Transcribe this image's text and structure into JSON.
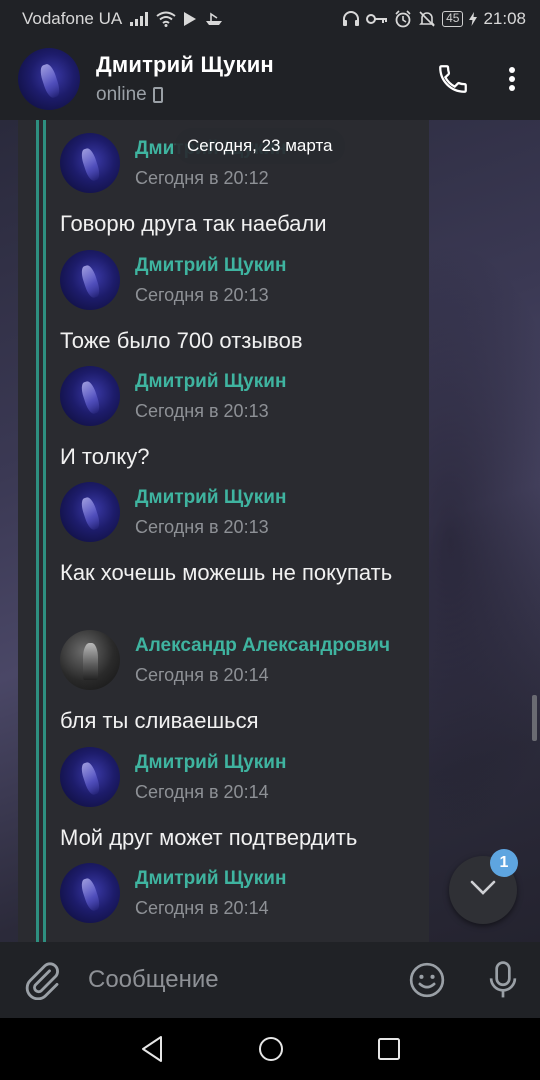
{
  "statusbar": {
    "carrier": "Vodafone UA",
    "battery": "45",
    "time": "21:08",
    "icons": [
      "signal-icon",
      "wifi-icon",
      "play-icon",
      "boat-icon",
      "headset-icon",
      "key-icon",
      "alarm-icon",
      "mute-icon",
      "charging-icon"
    ]
  },
  "header": {
    "name": "Дмитрий Щукин",
    "status": "online",
    "icons": [
      "back-avatar",
      "phone-call-icon",
      "more-vert-icon"
    ]
  },
  "chat": {
    "date_chip": "Сегодня, 23 марта",
    "messages": [
      {
        "author": "Дмитрий Щукин",
        "time": "Сегодня в 20:12",
        "text": "Говорю друга так наебали",
        "avatar": "user-a"
      },
      {
        "author": "Дмитрий Щукин",
        "time": "Сегодня в 20:13",
        "text": "Тоже было 700 отзывов",
        "avatar": "user-a"
      },
      {
        "author": "Дмитрий Щукин",
        "time": "Сегодня в 20:13",
        "text": "И толку?",
        "avatar": "user-a"
      },
      {
        "author": "Дмитрий Щукин",
        "time": "Сегодня в 20:13",
        "text": "Как хочешь можешь не покупать",
        "avatar": "user-a"
      },
      {
        "author": "Александр Александрович",
        "time": "Сегодня в 20:14",
        "text": "бля ты сливаешься",
        "avatar": "user-b"
      },
      {
        "author": "Дмитрий Щукин",
        "time": "Сегодня в 20:14",
        "text": "Мой друг может подтвердить",
        "avatar": "user-a"
      },
      {
        "author": "Дмитрий Щукин",
        "time": "Сегодня в 20:14",
        "text": "",
        "avatar": "user-a"
      }
    ],
    "unread_badge": "1"
  },
  "composer": {
    "placeholder": "Сообщение"
  },
  "colors": {
    "accent_author": "#3fb4a0",
    "quote_bar": "#2e8f80",
    "badge": "#5ea5e0"
  }
}
